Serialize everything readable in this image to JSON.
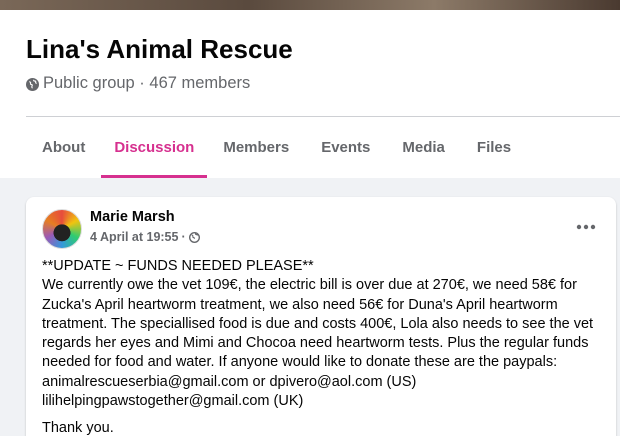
{
  "group": {
    "name": "Lina's Animal Rescue",
    "meta": "Public group · 467 members"
  },
  "tabs": [
    {
      "label": "About",
      "active": false
    },
    {
      "label": "Discussion",
      "active": true
    },
    {
      "label": "Members",
      "active": false
    },
    {
      "label": "Events",
      "active": false
    },
    {
      "label": "Media",
      "active": false
    },
    {
      "label": "Files",
      "active": false
    }
  ],
  "post": {
    "author": "Marie Marsh",
    "time": "4 April at 19:55",
    "separator": "·",
    "body": "**UPDATE ~ FUNDS NEEDED PLEASE**\nWe currently owe the vet 109€, the electric bill is over due at 270€, we need 58€ for Zucka's April heartworm treatment, we also need 56€ for Duna's April heartworm treatment. The speciallised food is due and costs 400€, Lola also needs to see the vet regards her eyes and Mimi and Chocoa need heartworm tests. Plus the regular funds needed for food and water. If anyone would like to donate these are the paypals: animalrescueserbia@gmail.com or dpivero@aol.com (US)\nlilihelpingpawstogether@gmail.com (UK)",
    "closing": "Thank you."
  },
  "colors": {
    "accent": "#d6308f",
    "secondary_text": "#65676b",
    "background": "#f0f2f5"
  },
  "icons": {
    "privacy": "globe-icon",
    "more": "more-options-icon"
  }
}
